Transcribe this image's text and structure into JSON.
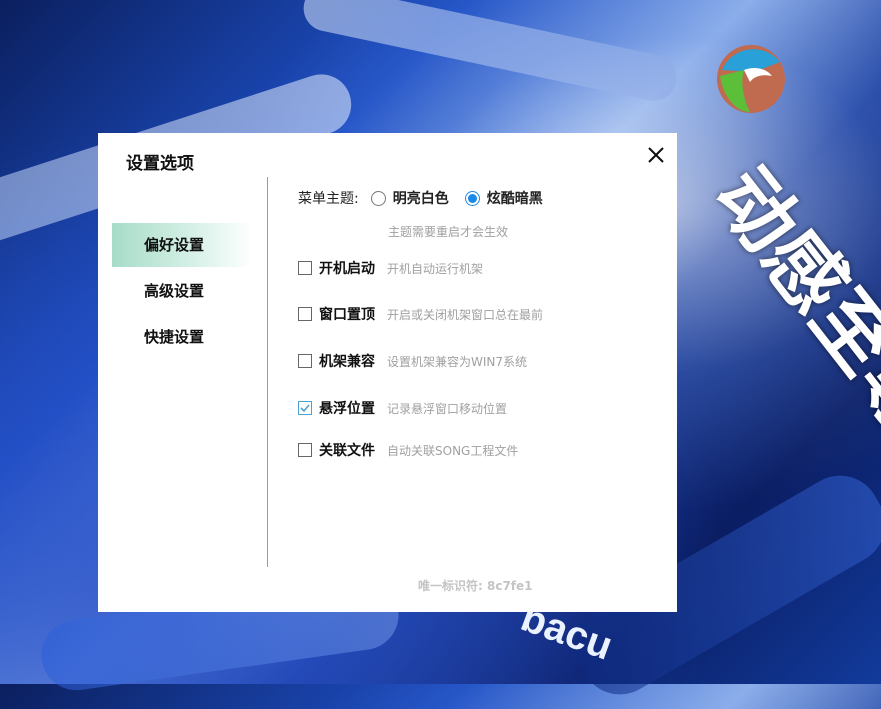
{
  "window": {
    "title": "设置选项"
  },
  "sidebar": {
    "items": [
      {
        "label": "偏好设置",
        "active": true
      },
      {
        "label": "高级设置",
        "active": false
      },
      {
        "label": "快捷设置",
        "active": false
      }
    ]
  },
  "theme": {
    "label": "菜单主题:",
    "options": [
      {
        "label": "明亮白色",
        "selected": false
      },
      {
        "label": "炫酷暗黑",
        "selected": true
      }
    ],
    "hint": "主题需要重启才会生效"
  },
  "options": [
    {
      "label": "开机启动",
      "desc": "开机自动运行机架",
      "checked": false
    },
    {
      "label": "窗口置顶",
      "desc": "开启或关闭机架窗口总在最前",
      "checked": false
    },
    {
      "label": "机架兼容",
      "desc": "设置机架兼容为WIN7系统",
      "checked": false
    },
    {
      "label": "悬浮位置",
      "desc": "记录悬浮窗口移动位置",
      "checked": true
    },
    {
      "label": "关联文件",
      "desc": "自动关联SONG工程文件",
      "checked": false
    }
  ],
  "footer": {
    "uid": "唯一标识符: 8c7fe1"
  },
  "background": {
    "slogan": "动感至尊",
    "badge": "bacu"
  },
  "colors": {
    "accent": "#1a8ae8",
    "active_nav": "#a7dcc8",
    "hint": "#a0a0a0"
  }
}
